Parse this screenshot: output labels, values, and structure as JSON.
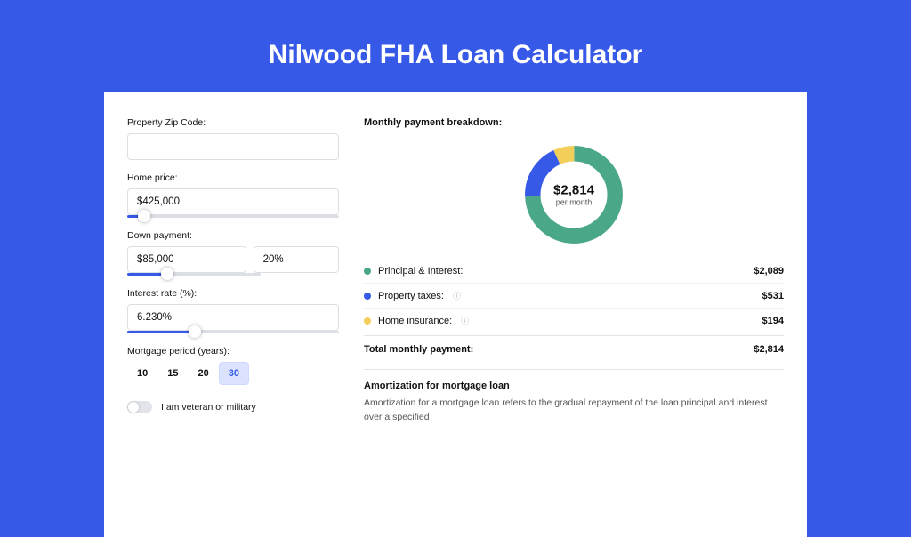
{
  "title": "Nilwood FHA Loan Calculator",
  "form": {
    "zipLabel": "Property Zip Code:",
    "zipValue": "",
    "homePriceLabel": "Home price:",
    "homePriceValue": "$425,000",
    "homePriceSliderPct": 8,
    "downPaymentLabel": "Down payment:",
    "downPaymentValue": "$85,000",
    "downPaymentPct": "20%",
    "downPaymentSliderPct": 20,
    "interestLabel": "Interest rate (%):",
    "interestValue": "6.230%",
    "interestSliderPct": 32,
    "mortgagePeriodLabel": "Mortgage period (years):",
    "periods": [
      {
        "label": "10",
        "active": false
      },
      {
        "label": "15",
        "active": false
      },
      {
        "label": "20",
        "active": false
      },
      {
        "label": "30",
        "active": true
      }
    ],
    "veteranLabel": "I am veteran or military"
  },
  "breakdown": {
    "title": "Monthly payment breakdown:",
    "centerAmount": "$2,814",
    "centerSub": "per month",
    "items": [
      {
        "label": "Principal & Interest:",
        "value": "$2,089",
        "color": "#4aa889",
        "hasInfo": false
      },
      {
        "label": "Property taxes:",
        "value": "$531",
        "color": "#3759e7",
        "hasInfo": true
      },
      {
        "label": "Home insurance:",
        "value": "$194",
        "color": "#f2ce5a",
        "hasInfo": true
      }
    ],
    "totalLabel": "Total monthly payment:",
    "totalValue": "$2,814"
  },
  "amort": {
    "title": "Amortization for mortgage loan",
    "text": "Amortization for a mortgage loan refers to the gradual repayment of the loan principal and interest over a specified"
  },
  "chart_data": {
    "type": "pie",
    "title": "Monthly payment breakdown",
    "series": [
      {
        "name": "Principal & Interest",
        "value": 2089,
        "color": "#4aa889"
      },
      {
        "name": "Property taxes",
        "value": 531,
        "color": "#3759e7"
      },
      {
        "name": "Home insurance",
        "value": 194,
        "color": "#f2ce5a"
      }
    ],
    "total": 2814,
    "center_label": "$2,814 per month"
  }
}
